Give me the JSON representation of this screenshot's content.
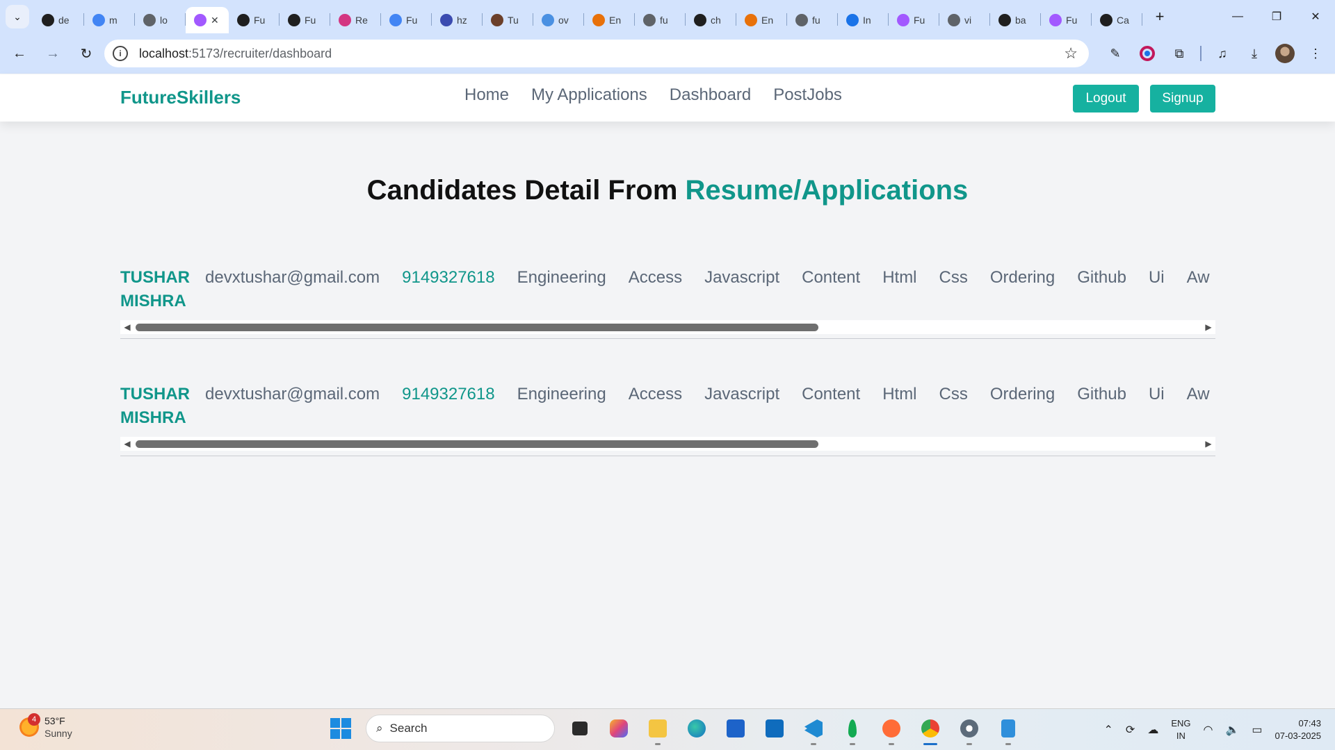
{
  "browser": {
    "tabs": [
      {
        "title": "de",
        "icon": "github-icon",
        "color": "#1f1f1f"
      },
      {
        "title": "m",
        "icon": "docs-icon",
        "color": "#4285f4"
      },
      {
        "title": "lo",
        "icon": "globe-icon",
        "color": "#5f6368"
      },
      {
        "title": "",
        "icon": "vite-icon",
        "color": "#a259ff",
        "active": true
      },
      {
        "title": "Fu",
        "icon": "chrome-icon",
        "color": "#1f1f1f"
      },
      {
        "title": "Fu",
        "icon": "chrome-icon",
        "color": "#1f1f1f"
      },
      {
        "title": "Re",
        "icon": "react-icon",
        "color": "#d33682"
      },
      {
        "title": "Fu",
        "icon": "docs-icon",
        "color": "#4285f4"
      },
      {
        "title": "hz",
        "icon": "cloud-icon",
        "color": "#3b4bb0"
      },
      {
        "title": "Tu",
        "icon": "avatar-icon",
        "color": "#6b3f2a"
      },
      {
        "title": "ov",
        "icon": "link-icon",
        "color": "#4a90e2"
      },
      {
        "title": "En",
        "icon": "app-icon",
        "color": "#e8710a"
      },
      {
        "title": "fu",
        "icon": "globe-icon",
        "color": "#5f6368"
      },
      {
        "title": "ch",
        "icon": "chrome-icon",
        "color": "#1f1f1f"
      },
      {
        "title": "En",
        "icon": "app-icon",
        "color": "#e8710a"
      },
      {
        "title": "fu",
        "icon": "globe-icon",
        "color": "#5f6368"
      },
      {
        "title": "In",
        "icon": "is-icon",
        "color": "#1a73e8"
      },
      {
        "title": "Fu",
        "icon": "vite-icon",
        "color": "#a259ff"
      },
      {
        "title": "vi",
        "icon": "globe-icon",
        "color": "#5f6368"
      },
      {
        "title": "ba",
        "icon": "github-icon",
        "color": "#1f1f1f"
      },
      {
        "title": "Fu",
        "icon": "vite-icon",
        "color": "#a259ff"
      },
      {
        "title": "Ca",
        "icon": "openai-icon",
        "color": "#1f1f1f"
      }
    ],
    "url_host": "localhost",
    "url_rest": ":5173/recruiter/dashboard"
  },
  "nav": {
    "brand": "FutureSkillers",
    "links": [
      "Home",
      "My Applications",
      "Dashboard",
      "PostJobs"
    ],
    "logout": "Logout",
    "signup": "Signup"
  },
  "page": {
    "heading_main": "Candidates Detail From ",
    "heading_accent": "Resume/Applications"
  },
  "candidates": [
    {
      "name": "TUSHAR MISHRA",
      "email": "devxtushar@gmail.com",
      "phone": "9149327618",
      "skills": [
        "Engineering",
        "Access",
        "Javascript",
        "Content",
        "Html",
        "Css",
        "Ordering",
        "Github",
        "Ui",
        "Aw"
      ]
    },
    {
      "name": "TUSHAR MISHRA",
      "email": "devxtushar@gmail.com",
      "phone": "9149327618",
      "skills": [
        "Engineering",
        "Access",
        "Javascript",
        "Content",
        "Html",
        "Css",
        "Ordering",
        "Github",
        "Ui",
        "Aw"
      ]
    }
  ],
  "taskbar": {
    "weather_badge": "4",
    "temp": "53°F",
    "condition": "Sunny",
    "search": "Search",
    "lang_top": "ENG",
    "lang_bottom": "IN",
    "time": "07:43",
    "date": "07-03-2025"
  },
  "colors": {
    "accent": "#10968a",
    "button": "#16b1a0",
    "browser_frame": "#d3e3fd"
  }
}
